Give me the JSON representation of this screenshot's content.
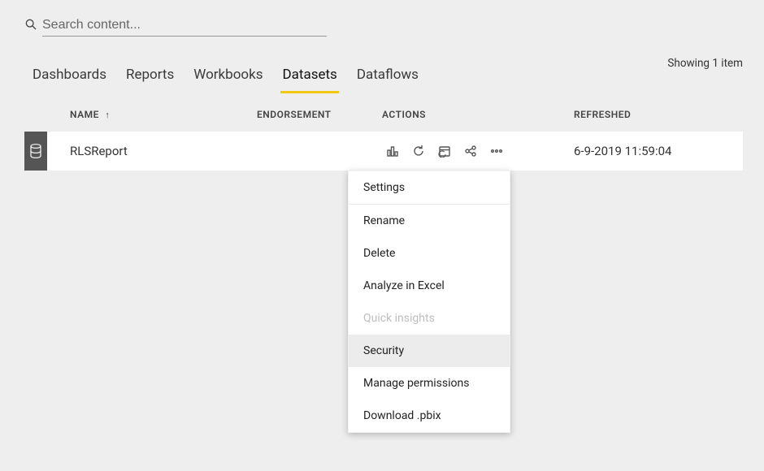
{
  "search": {
    "placeholder": "Search content..."
  },
  "status": {
    "text": "Showing 1 item"
  },
  "tabs": [
    {
      "label": "Dashboards",
      "active": false
    },
    {
      "label": "Reports",
      "active": false
    },
    {
      "label": "Workbooks",
      "active": false
    },
    {
      "label": "Datasets",
      "active": true
    },
    {
      "label": "Dataflows",
      "active": false
    }
  ],
  "columns": {
    "name": "NAME",
    "endorsement": "ENDORSEMENT",
    "actions": "ACTIONS",
    "refreshed": "REFRESHED",
    "sort_arrow": "↑"
  },
  "row": {
    "name": "RLSReport",
    "refreshed": "6-9-2019 11:59:04"
  },
  "action_icons": {
    "chart": "chart-icon",
    "refresh": "refresh-icon",
    "schedule": "schedule-refresh-icon",
    "share": "share-icon",
    "more": "more-options-icon"
  },
  "menu": {
    "items": [
      {
        "label": "Settings",
        "state": "first"
      },
      {
        "label": "Rename",
        "state": ""
      },
      {
        "label": "Delete",
        "state": ""
      },
      {
        "label": "Analyze in Excel",
        "state": ""
      },
      {
        "label": "Quick insights",
        "state": "disabled"
      },
      {
        "label": "Security",
        "state": "highlight"
      },
      {
        "label": "Manage permissions",
        "state": ""
      },
      {
        "label": "Download .pbix",
        "state": ""
      }
    ]
  }
}
